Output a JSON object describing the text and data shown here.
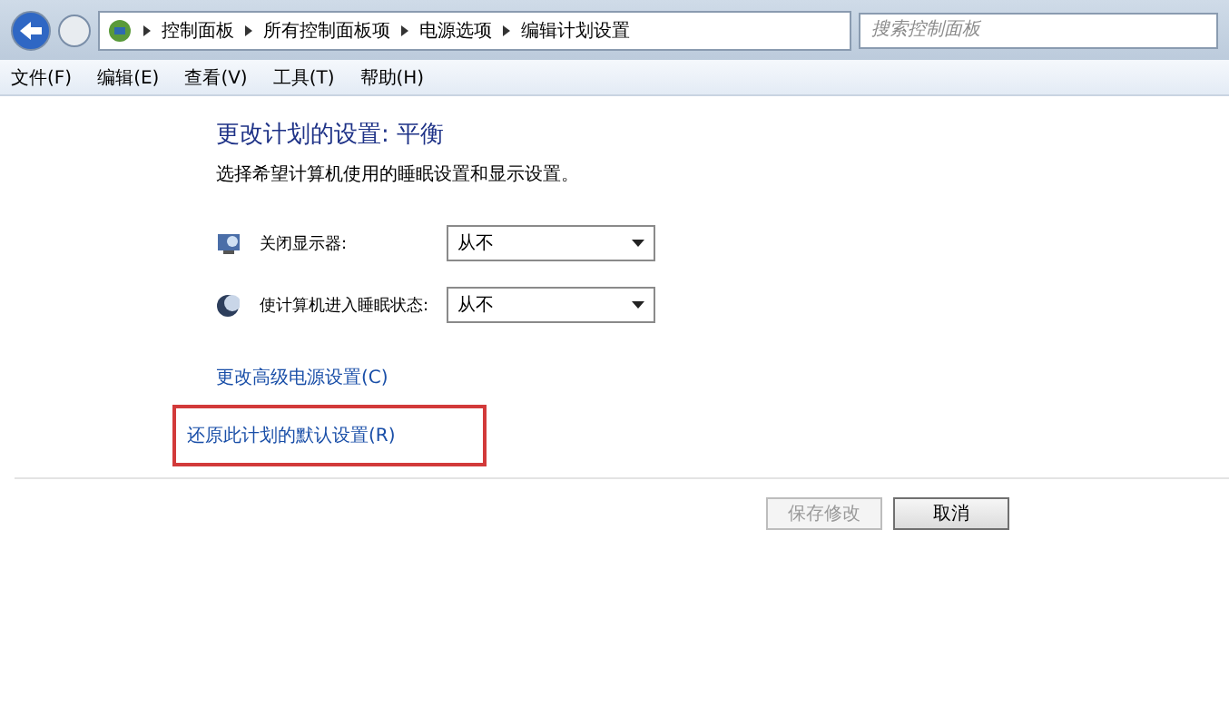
{
  "breadcrumb": [
    "控制面板",
    "所有控制面板项",
    "电源选项",
    "编辑计划设置"
  ],
  "search": {
    "placeholder": "搜索控制面板"
  },
  "menu": [
    "文件(F)",
    "编辑(E)",
    "查看(V)",
    "工具(T)",
    "帮助(H)"
  ],
  "heading": "更改计划的设置: 平衡",
  "subtitle": "选择希望计算机使用的睡眠设置和显示设置。",
  "settings": [
    {
      "kind": "display",
      "label": "关闭显示器:",
      "value": "从不"
    },
    {
      "kind": "sleep",
      "label": "使计算机进入睡眠状态:",
      "value": "从不"
    }
  ],
  "links": [
    {
      "text": "更改高级电源设置(C)",
      "highlighted": false
    },
    {
      "text": "还原此计划的默认设置(R)",
      "highlighted": true
    }
  ],
  "buttons": [
    {
      "label": "保存修改",
      "disabled": true
    },
    {
      "label": "取消",
      "disabled": false
    }
  ]
}
